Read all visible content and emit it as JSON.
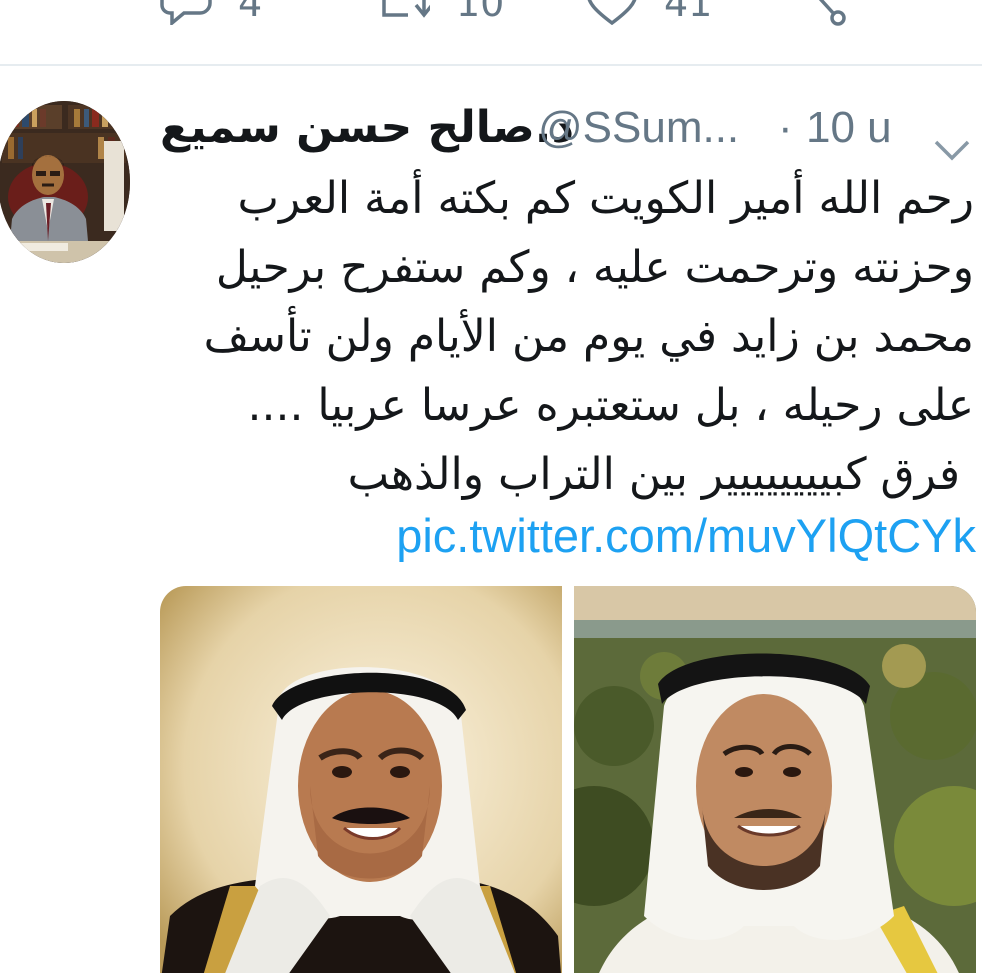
{
  "actions": {
    "reply_count": "4",
    "retweet_count": "10",
    "like_count": "41"
  },
  "tweet": {
    "display_name": "د.صالح حسن سميع",
    "handle": "@SSum...",
    "separator": "·",
    "time": "10 u",
    "text_lines": [
      "رحم الله أمير الكويت كم بكته أمة العرب",
      "وحزنته وترحمت عليه ، وكم ستفرح برحيل",
      "محمد بن زايد في يوم من الأيام ولن تأسف",
      "على رحيله ، بل ستعتبره عرسا عربيا ....",
      "فرق كبيييييييير بين التراب والذهب"
    ],
    "link": "pic.twitter.com/muvYlQtCYk"
  },
  "icons": {
    "reply": "reply-icon",
    "retweet": "retweet-icon",
    "like": "heart-icon",
    "share": "share-icon",
    "caret": "chevron-down-icon"
  },
  "colors": {
    "text": "#14171a",
    "muted": "#657786",
    "link": "#1da1f2",
    "divider": "#e6ecf0"
  }
}
